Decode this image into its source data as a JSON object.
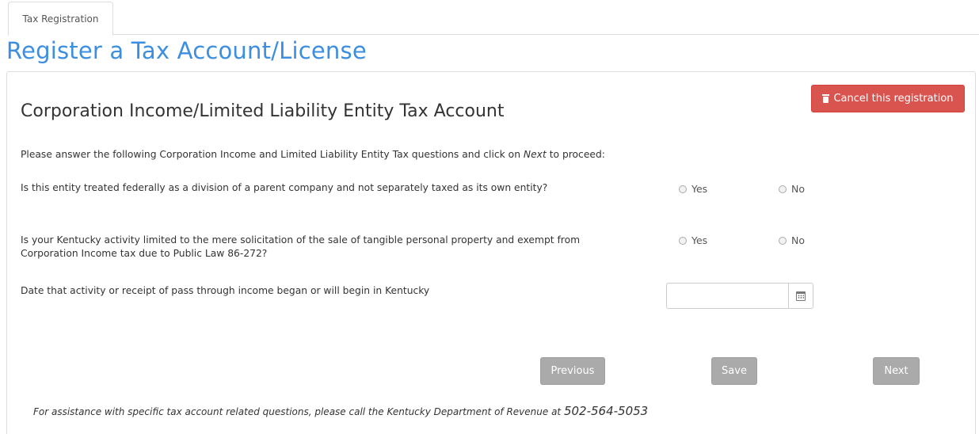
{
  "tabs": [
    {
      "label": "Tax Registration"
    }
  ],
  "page_title": "Register a Tax Account/License",
  "cancel_button": {
    "label": "Cancel this registration",
    "icon": "trash-icon",
    "color": "#d9534f"
  },
  "section_title": "Corporation Income/Limited Liability Entity Tax Account",
  "intro": {
    "before": "Please answer the following Corporation Income and Limited Liability Entity Tax questions and click on ",
    "emphasis": "Next",
    "after": " to proceed:"
  },
  "questions": [
    {
      "text": "Is this entity treated federally as a division of a parent company and not separately taxed as its own entity?",
      "options": [
        "Yes",
        "No"
      ]
    },
    {
      "text": "Is your Kentucky activity limited to the mere solicitation of the sale of tangible personal property and exempt from Corporation Income tax due to Public Law 86-272?",
      "options": [
        "Yes",
        "No"
      ]
    }
  ],
  "date_question": {
    "text": "Date that activity or receipt of pass through income began or will begin in Kentucky",
    "value": "",
    "icon": "calendar-icon"
  },
  "nav_buttons": {
    "previous": "Previous",
    "save": "Save",
    "next": "Next"
  },
  "assistance": {
    "text": "For assistance with specific tax account related questions, please call the Kentucky Department of Revenue at ",
    "phone": "502-564-5053"
  },
  "colors": {
    "title_blue": "#3b8ee0",
    "button_gray": "#aaaaaa",
    "danger": "#d9534f"
  }
}
